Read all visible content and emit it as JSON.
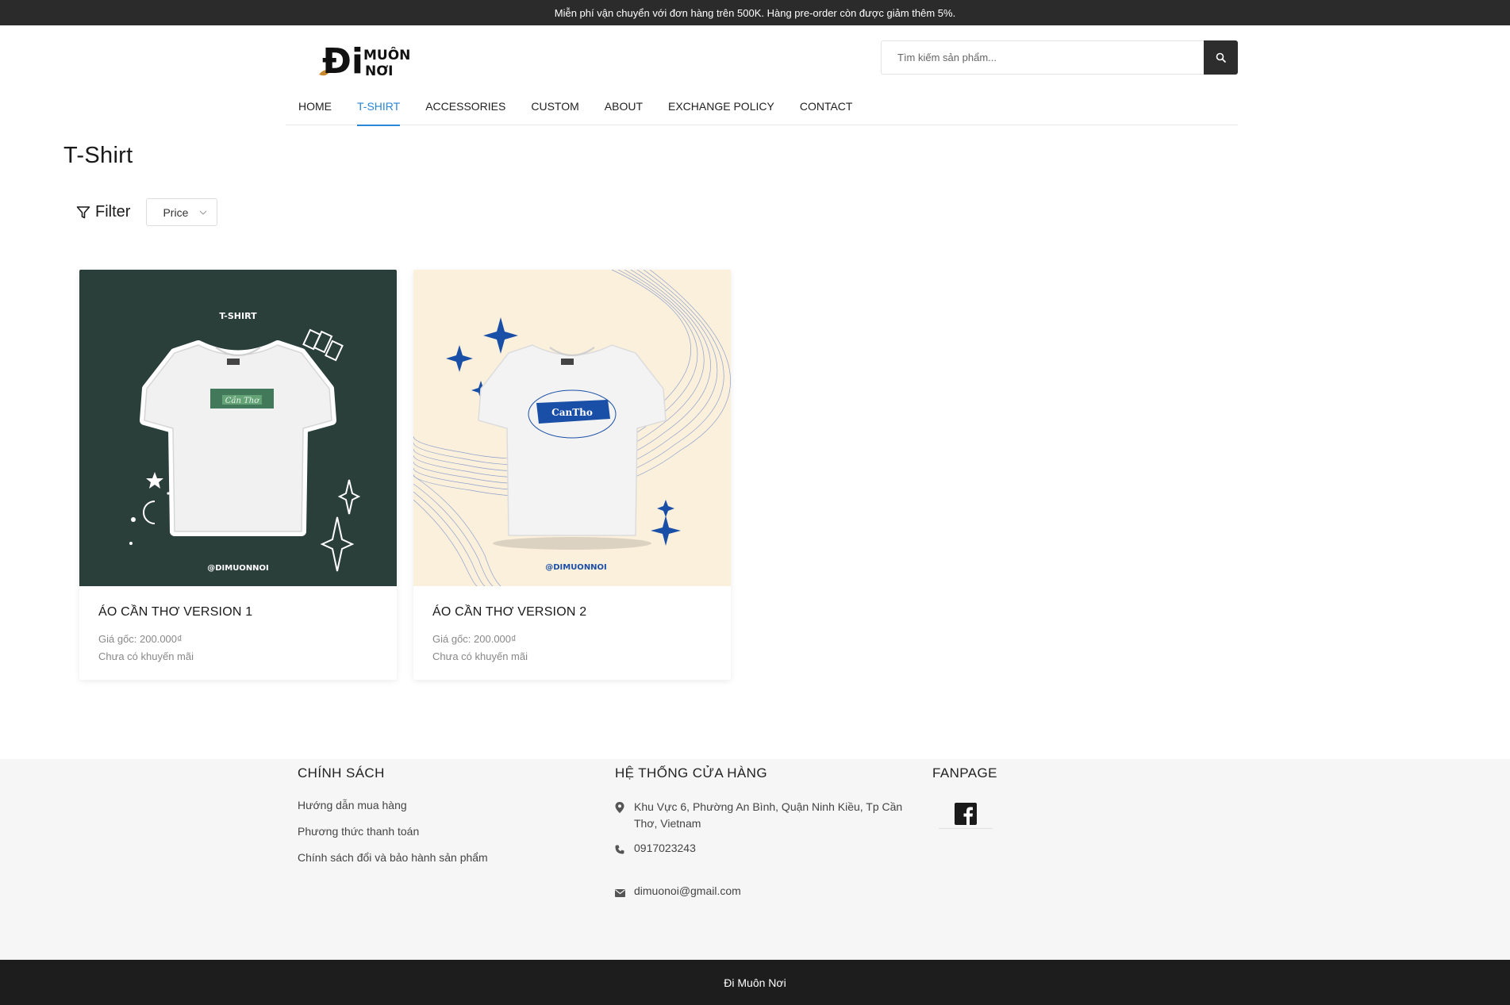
{
  "topbar": {
    "message": "Miễn phí vận chuyển với đơn hàng trên 500K. Hàng pre-order còn được giảm thêm 5%."
  },
  "logo": {
    "line1": "Đi",
    "line2": "MUÔN",
    "line3": "NƠI"
  },
  "search": {
    "placeholder": "Tìm kiếm sản phẩm..."
  },
  "nav": {
    "items": [
      {
        "label": "HOME"
      },
      {
        "label": "T-SHIRT"
      },
      {
        "label": "ACCESSORIES"
      },
      {
        "label": "CUSTOM"
      },
      {
        "label": "ABOUT"
      },
      {
        "label": "EXCHANGE POLICY"
      },
      {
        "label": "CONTACT"
      }
    ],
    "active": "T-SHIRT"
  },
  "page": {
    "title": "T-Shirt"
  },
  "filter": {
    "label": "Filter",
    "price_label": "Price"
  },
  "products": [
    {
      "name": "ÁO CẦN THƠ VERSION 1",
      "price": "Giá gốc: 200.000₫",
      "promo": "Chưa có khuyến mãi",
      "img_top": "T-SHIRT",
      "img_handle": "@DIMUONNOI"
    },
    {
      "name": "ÁO CẦN THƠ VERSION 2",
      "price": "Giá gốc: 200.000₫",
      "promo": "Chưa có khuyến mãi",
      "img_handle": "@DIMUONNOI",
      "img_print": "CanTho"
    }
  ],
  "footer": {
    "policy": {
      "title": "CHÍNH SÁCH",
      "links": [
        "Hướng dẫn mua hàng",
        "Phương thức thanh toán",
        "Chính sách đổi và bảo hành sản phẩm"
      ]
    },
    "stores": {
      "title": "HỆ THỐNG CỬA HÀNG",
      "address": "Khu Vực 6, Phường An Bình, Quận Ninh Kiều, Tp Cần Thơ, Vietnam",
      "phone": "0917023243",
      "email": "dimuonoi@gmail.com"
    },
    "fanpage": {
      "title": "FANPAGE"
    }
  },
  "bottombar": {
    "text": "Đi Muôn Nơi"
  },
  "colors": {
    "accent": "#2a86d6",
    "dark": "#2b2b2b",
    "card1_bg": "#2b3f3a",
    "card2_bg": "#fbf0dc",
    "card2_accent": "#1a4fa8"
  }
}
